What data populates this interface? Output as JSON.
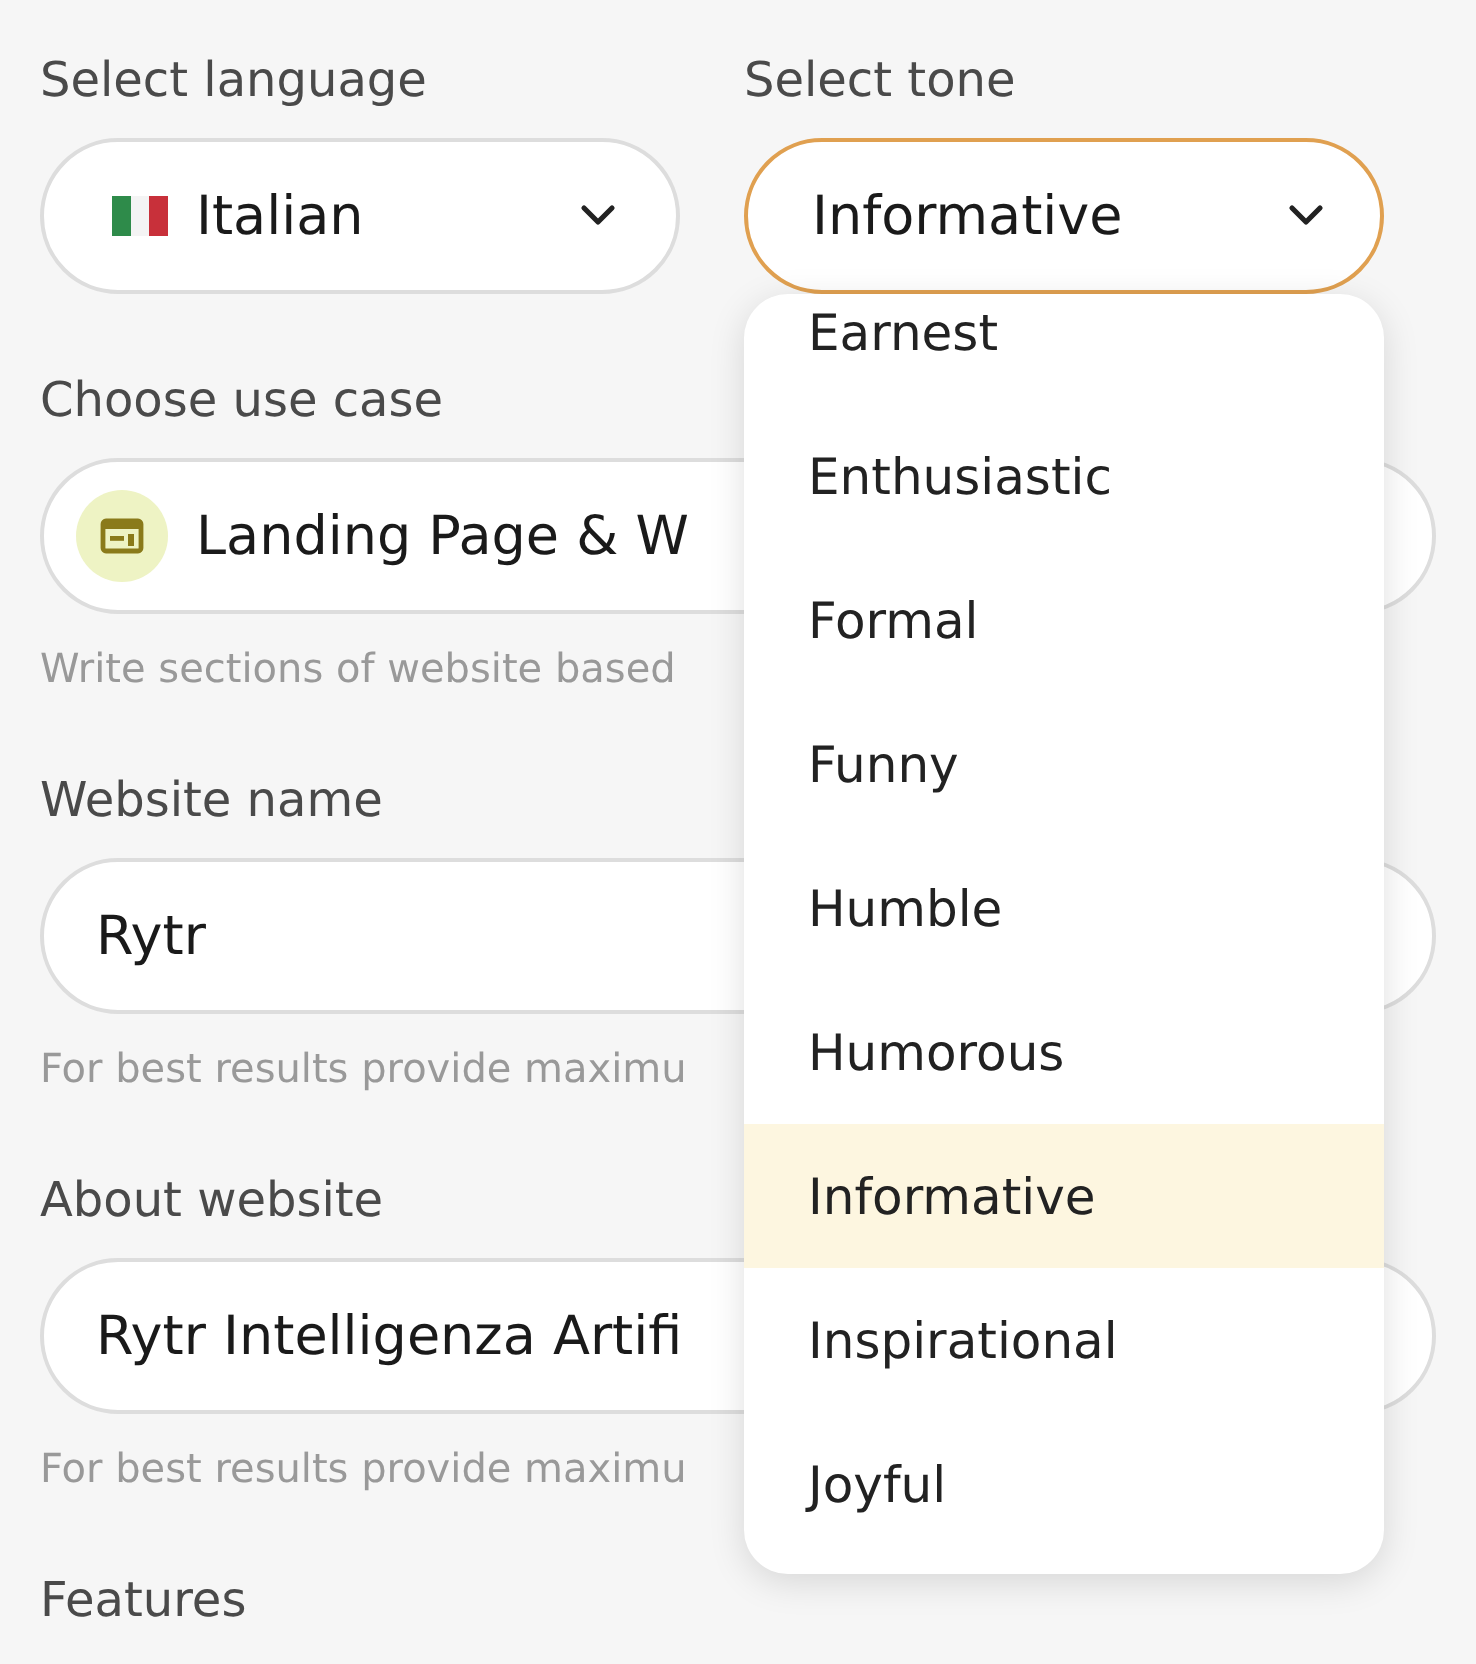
{
  "language": {
    "label": "Select language",
    "value": "Italian"
  },
  "tone": {
    "label": "Select tone",
    "value": "Informative",
    "focused": true,
    "menu": [
      {
        "label": "Earnest",
        "selected": false
      },
      {
        "label": "Enthusiastic",
        "selected": false
      },
      {
        "label": "Formal",
        "selected": false
      },
      {
        "label": "Funny",
        "selected": false
      },
      {
        "label": "Humble",
        "selected": false
      },
      {
        "label": "Humorous",
        "selected": false
      },
      {
        "label": "Informative",
        "selected": true
      },
      {
        "label": "Inspirational",
        "selected": false
      },
      {
        "label": "Joyful",
        "selected": false
      }
    ]
  },
  "fields": [
    {
      "kind": "select",
      "label": "Choose use case",
      "value": "Landing Page & W",
      "hint": "Write sections of website based"
    },
    {
      "kind": "input",
      "label": "Website name",
      "value": "Rytr",
      "hint": "For best results provide maximu"
    },
    {
      "kind": "input",
      "label": "About website",
      "value": "Rytr Intelligenza Artifi",
      "hint": "For best results provide maximu"
    },
    {
      "kind": "label",
      "label": "Features"
    }
  ]
}
